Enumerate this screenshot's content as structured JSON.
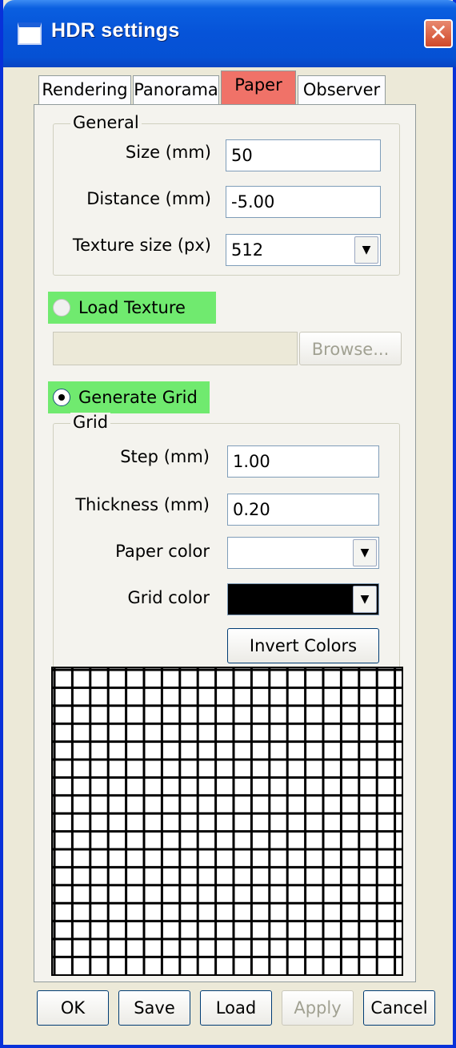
{
  "window": {
    "title": "HDR settings"
  },
  "tabs": [
    {
      "label": "Rendering",
      "active": false
    },
    {
      "label": "Panorama",
      "active": false
    },
    {
      "label": "Paper",
      "active": true
    },
    {
      "label": "Observer",
      "active": false
    }
  ],
  "general": {
    "group_label": "General",
    "size_label": "Size (mm)",
    "size_value": "50",
    "distance_label": "Distance (mm)",
    "distance_value": "-5.00",
    "texture_label": "Texture size (px)",
    "texture_value": "512"
  },
  "load_texture": {
    "label": "Load Texture",
    "checked": false,
    "path_value": "",
    "browse_label": "Browse..."
  },
  "generate_grid": {
    "label": "Generate Grid",
    "checked": true
  },
  "grid": {
    "group_label": "Grid",
    "step_label": "Step (mm)",
    "step_value": "1.00",
    "thickness_label": "Thickness (mm)",
    "thickness_value": "0.20",
    "paper_color_label": "Paper color",
    "paper_color": "#ffffff",
    "grid_color_label": "Grid color",
    "grid_color": "#000000",
    "invert_label": "Invert Colors"
  },
  "footer": {
    "ok": "OK",
    "save": "Save",
    "load": "Load",
    "apply": "Apply",
    "cancel": "Cancel"
  },
  "colors": {
    "active_tab": "#f07268",
    "radio_highlight": "#70ea6f",
    "title_bar": "#0653d8"
  },
  "icons": {
    "close": "close-icon",
    "dropdown": "chevron-down-icon"
  }
}
